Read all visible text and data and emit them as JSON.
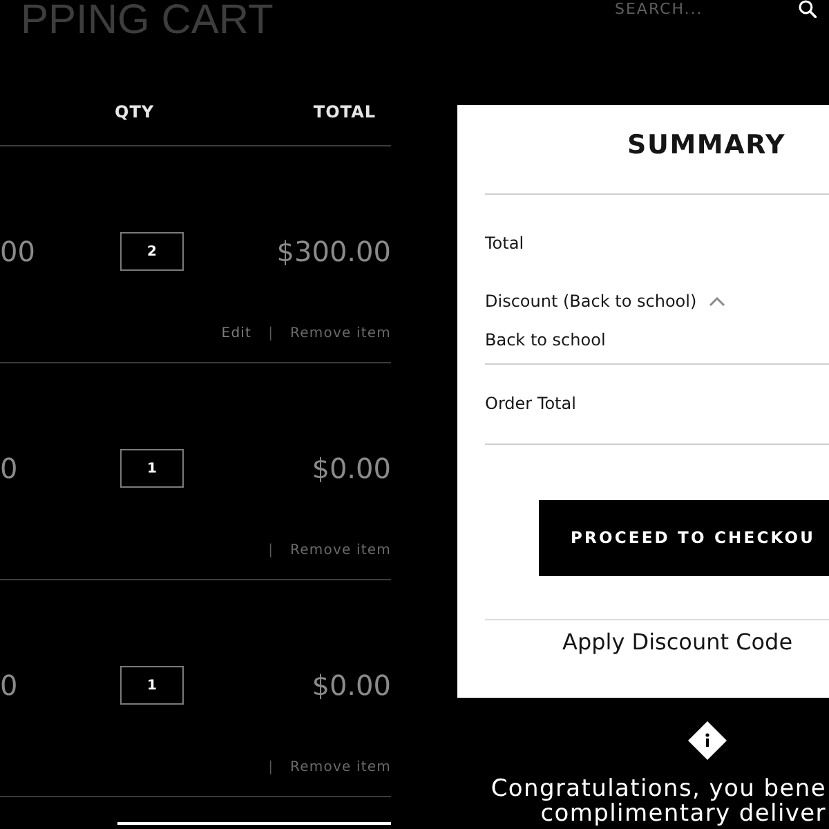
{
  "header": {
    "title": "PPING CART",
    "search": {
      "placeholder": "SEARCH..."
    }
  },
  "cart": {
    "columns": [
      "QTY",
      "TOTAL"
    ],
    "rows": [
      {
        "column_1": "00",
        "qty": "2",
        "total": "$300.00",
        "actions": [
          {
            "kind": "edit",
            "label": "Edit"
          },
          {
            "kind": "separator",
            "label": "|"
          },
          {
            "kind": "remove",
            "label": "Remove item"
          }
        ]
      },
      {
        "column_1": "0",
        "qty": "1",
        "total": "$0.00",
        "actions": [
          {
            "kind": "separator",
            "label": "|"
          },
          {
            "kind": "remove",
            "label": "Remove item"
          }
        ]
      },
      {
        "column_1": "0",
        "qty": "1",
        "total": "$0.00",
        "actions": [
          {
            "kind": "separator",
            "label": "|"
          },
          {
            "kind": "remove",
            "label": "Remove item"
          }
        ]
      }
    ]
  },
  "summary": {
    "title": "SUMMARY",
    "lines": [
      {
        "kind": "subtotal",
        "label": "Total"
      },
      {
        "kind": "discount",
        "label": "Discount (Back to school)",
        "expanded": true,
        "detail": "Back to school"
      },
      {
        "kind": "grand_total",
        "label": "Order Total"
      }
    ],
    "checkout_button": "PROCEED TO CHECKOU",
    "discount_link": "Apply Discount Code"
  },
  "notice": {
    "lines": [
      "Congratulations, you bene",
      "complimentary deliver"
    ]
  }
}
